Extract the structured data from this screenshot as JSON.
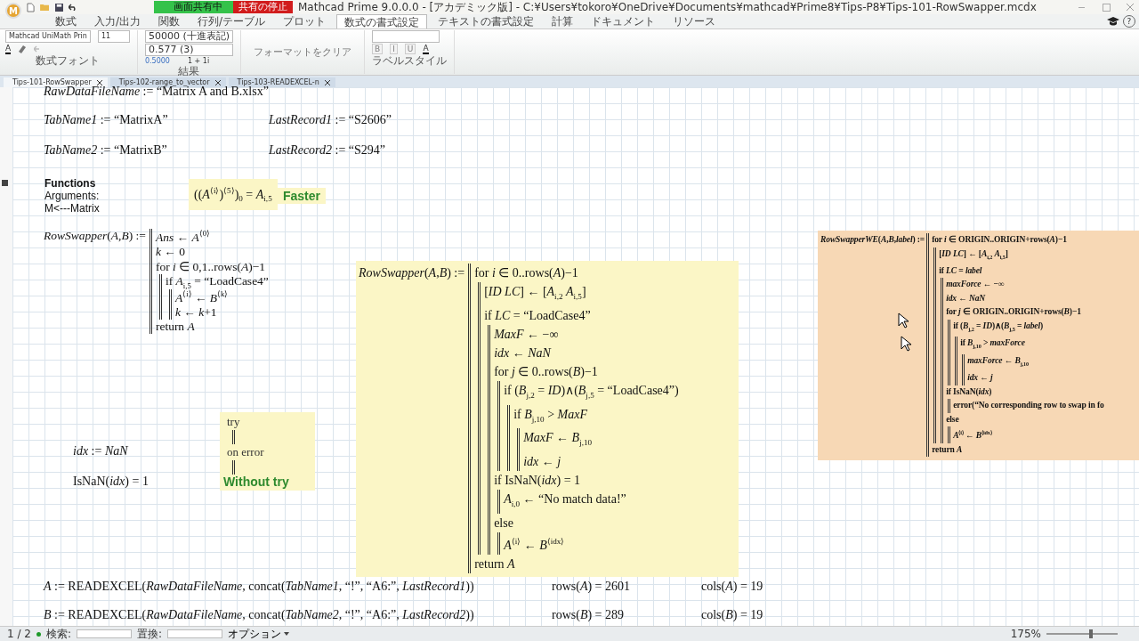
{
  "window": {
    "title": "Mathcad Prime 9.0.0.0 - [アカデミック版] - C:¥Users¥tokoro¥OneDrive¥Documents¥mathcad¥Prime8¥Tips-P8¥Tips-101-RowSwapper.mcdx"
  },
  "share_banner": {
    "status": "画面共有中",
    "stop": "共有の停止"
  },
  "ribbon_tabs": [
    {
      "label": "数式",
      "selected": false
    },
    {
      "label": "入力/出力",
      "selected": false
    },
    {
      "label": "関数",
      "selected": false
    },
    {
      "label": "行列/テーブル",
      "selected": false
    },
    {
      "label": "プロット",
      "selected": false
    },
    {
      "label": "数式の書式設定",
      "selected": true
    },
    {
      "label": "テキストの書式設定",
      "selected": false
    },
    {
      "label": "計算",
      "selected": false
    },
    {
      "label": "ドキュメント",
      "selected": false
    },
    {
      "label": "リソース",
      "selected": false
    }
  ],
  "ribbon": {
    "font": "Mathcad UniMath Prin",
    "size": "11",
    "font_group": "数式フォント",
    "result_format": "50000 (十進表記)",
    "precision": "0.577 (3)",
    "sample_number": "0.5000",
    "sample_complex": "1 + 1i",
    "result_group": "結果",
    "clear_format": "フォーマットをクリア",
    "label_group": "ラベルスタイル",
    "font_color": "A",
    "format_buttons": [
      {
        "label": "B",
        "disabled": true
      },
      {
        "label": "I",
        "disabled": true
      },
      {
        "label": "U",
        "disabled": true
      }
    ],
    "label_color": "A"
  },
  "app_logo": "M",
  "help": "?",
  "doc_tabs": [
    {
      "label": "Tips-101-RowSwapper",
      "selected": true
    },
    {
      "label": "Tips-102-range_to_vector",
      "selected": false
    },
    {
      "label": "Tips-103-READEXCEL-n",
      "selected": false
    }
  ],
  "regions": [
    {
      "kind": "math",
      "text": "*RawDataFileName* := “Matrix A and B.xlsx”"
    },
    {
      "kind": "math",
      "text": "*TabName1* := “MatrixA”"
    },
    {
      "kind": "math",
      "text": "*LastRecord1* := “S2606”"
    },
    {
      "kind": "math",
      "text": "*TabName2* := “MatrixB”"
    },
    {
      "kind": "math",
      "text": "*LastRecord2* := “S294”"
    },
    {
      "kind": "text",
      "title": "Functions",
      "lines": [
        "Arguments:",
        "M<---Matrix"
      ]
    },
    {
      "kind": "math_highlight",
      "text": "((*A*$^{⟨i⟩}$)$^{⟨5⟩}$)$_{0}$ = *A*$_{i,5}$"
    },
    {
      "kind": "note",
      "text": "Faster"
    },
    {
      "kind": "program",
      "head": "*RowSwapper*(*A*,*B*) :=",
      "body": [
        {
          "text": "*Ans* ← *A*$^{⟨0⟩}$"
        },
        {
          "text": "*k* ← 0"
        },
        {
          "text": "for *i* ∈ 0,1..rows(*A*)−1",
          "children": [
            {
              "text": "if *A*$_{i,5}$ = “LoadCase4”",
              "children": [
                {
                  "text": "*A*$^{⟨i⟩}$ ← *B*$^{⟨k⟩}$"
                },
                {
                  "text": "*k* ← *k*+1"
                }
              ]
            }
          ]
        },
        {
          "text": "return *A*"
        }
      ]
    },
    {
      "kind": "program",
      "head": "*RowSwapper*(*A*,*B*) :=",
      "body": [
        {
          "text": "for *i* ∈ 0..rows(*A*)−1",
          "children": [
            {
              "text": "[*ID* *LC*] ← [*A*$_{i,2}$ *A*$_{i,5}$]"
            },
            {
              "text": "if *LC* = “LoadCase4”",
              "children": [
                {
                  "text": "*MaxF* ← −∞"
                },
                {
                  "text": "*idx* ← *NaN*"
                },
                {
                  "text": "for *j* ∈ 0..rows(*B*)−1",
                  "children": [
                    {
                      "text": "if (*B*$_{j,2}$ = *ID*)∧(*B*$_{j,5}$ = “LoadCase4”)",
                      "children": [
                        {
                          "text": "if *B*$_{j,10}$ > *MaxF*",
                          "children": [
                            {
                              "text": "*MaxF* ← *B*$_{j,10}$"
                            },
                            {
                              "text": "*idx* ← *j*"
                            }
                          ]
                        }
                      ]
                    }
                  ]
                },
                {
                  "text": "if IsNaN(*idx*) = 1",
                  "children": [
                    {
                      "text": "*A*$_{i,0}$ ← “No match data!”"
                    }
                  ]
                },
                {
                  "text": "else",
                  "children": [
                    {
                      "text": "*A*$^{⟨i⟩}$ ← *B*$^{⟨idx⟩}$"
                    }
                  ]
                }
              ]
            }
          ]
        },
        {
          "text": "return *A*"
        }
      ]
    },
    {
      "kind": "math",
      "text": "*idx* := *NaN*"
    },
    {
      "kind": "math",
      "text": "IsNaN(*idx*) = 1"
    },
    {
      "kind": "try",
      "keywords": [
        "try",
        "on error"
      ],
      "note": "Without try"
    },
    {
      "kind": "program",
      "head": "*RowSwapperWE*(*A*,*B*,*label*) :=",
      "body": [
        {
          "text": "for *i* ∈ ORIGIN..ORIGIN+rows(*A*)−1",
          "children": [
            {
              "text": "[*ID* *LC*] ← [*A*$_{i,2}$ *A*$_{i,5}$]"
            },
            {
              "text": "if *LC* = *label*",
              "children": [
                {
                  "text": "*maxForce* ← −∞"
                },
                {
                  "text": "*idx* ← *NaN*"
                },
                {
                  "text": "for *j* ∈ ORIGIN..ORIGIN+rows(*B*)−1",
                  "children": [
                    {
                      "text": "if (*B*$_{j,2}$ = *ID*)∧(*B*$_{j,5}$ = *label*)",
                      "children": [
                        {
                          "text": "if *B*$_{j,10}$ > *maxForce*",
                          "children": [
                            {
                              "text": "*maxForce* ← *B*$_{j,10}$"
                            },
                            {
                              "text": "*idx* ← *j*"
                            }
                          ]
                        }
                      ]
                    }
                  ]
                },
                {
                  "text": "if IsNaN(*idx*)",
                  "children": [
                    {
                      "text": "error(“No corresponding row to swap in fo"
                    }
                  ]
                },
                {
                  "text": "else",
                  "children": [
                    {
                      "text": "*A*$^{⟨i⟩}$ ← *B*$^{⟨idx⟩}$"
                    }
                  ]
                }
              ]
            }
          ]
        },
        {
          "text": "return *A*"
        }
      ]
    },
    {
      "kind": "math",
      "text": "*A* := READEXCEL(*RawDataFileName*, concat(*TabName1*, “!”, “A6:”, *LastRecord1*))"
    },
    {
      "kind": "math",
      "text": "rows(*A*) = 2601"
    },
    {
      "kind": "math",
      "text": "cols(*A*) = 19"
    },
    {
      "kind": "math",
      "text": "*B* := READEXCEL(*RawDataFileName*, concat(*TabName2*, “!”, “A6:”, *LastRecord2*))"
    },
    {
      "kind": "math",
      "text": "rows(*B*) = 289"
    },
    {
      "kind": "math",
      "text": "cols(*B*) = 19"
    }
  ],
  "status_bar": {
    "page": "1 / 2",
    "find_label": "検索:",
    "replace_label": "置換:",
    "options": "オプション",
    "zoom": "175%",
    "zoom_slider": {
      "level": 0.62
    }
  }
}
